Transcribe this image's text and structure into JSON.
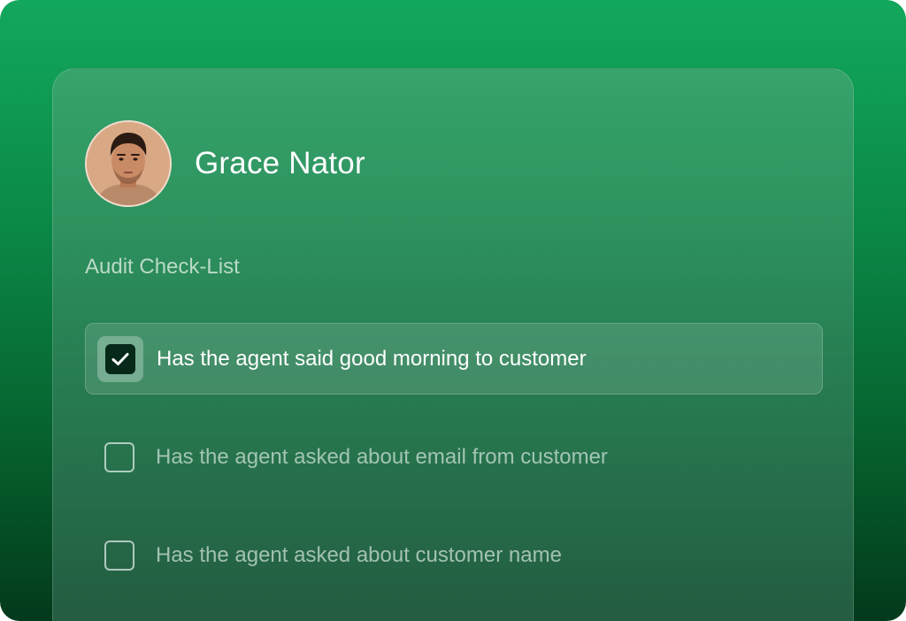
{
  "profile": {
    "name": "Grace Nator"
  },
  "checklist": {
    "title": "Audit Check-List",
    "items": [
      {
        "label": "Has the agent said good morning to customer",
        "checked": true
      },
      {
        "label": "Has the agent asked about email from customer",
        "checked": false
      },
      {
        "label": "Has the agent asked about customer name",
        "checked": false
      }
    ]
  },
  "colors": {
    "background_top": "#12a85c",
    "background_bottom": "#033a1b",
    "checked_box": "#06291a",
    "text_primary": "#ffffff"
  },
  "icons": {
    "avatar": "user-avatar-photo",
    "checkmark": "checkmark-icon"
  }
}
